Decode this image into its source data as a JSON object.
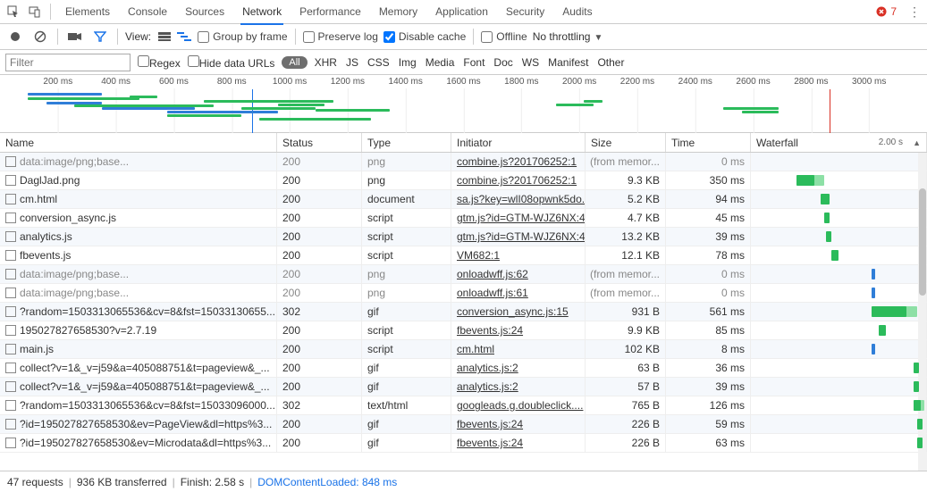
{
  "tabs": [
    "Elements",
    "Console",
    "Sources",
    "Network",
    "Performance",
    "Memory",
    "Application",
    "Security",
    "Audits"
  ],
  "active_tab_index": 3,
  "error_count": "7",
  "toolbar": {
    "view_label": "View:",
    "group_by_frame": "Group by frame",
    "preserve_log": "Preserve log",
    "disable_cache": "Disable cache",
    "disable_cache_checked": true,
    "offline": "Offline",
    "no_throttling": "No throttling"
  },
  "filter": {
    "placeholder": "Filter",
    "regex": "Regex",
    "hide_data_urls": "Hide data URLs",
    "all": "All",
    "types": [
      "XHR",
      "JS",
      "CSS",
      "Img",
      "Media",
      "Font",
      "Doc",
      "WS",
      "Manifest",
      "Other"
    ]
  },
  "overview": {
    "ticks": [
      "200 ms",
      "400 ms",
      "600 ms",
      "800 ms",
      "1000 ms",
      "1200 ms",
      "1400 ms",
      "1600 ms",
      "1800 ms",
      "2000 ms",
      "2200 ms",
      "2400 ms",
      "2600 ms",
      "2800 ms",
      "3000 ms"
    ],
    "blue_line_pct": 27.2,
    "red_line_pct": 89.5
  },
  "columns": {
    "name": "Name",
    "status": "Status",
    "type": "Type",
    "initiator": "Initiator",
    "size": "Size",
    "time": "Time",
    "waterfall": "Waterfall",
    "waterfall_mark": "2.00 s"
  },
  "rows": [
    {
      "name": "data:image/png;base...",
      "status": "200",
      "type": "png",
      "initiator": "combine.js?201706252:1",
      "size": "(from memor...",
      "time": "0 ms",
      "grey": true,
      "wf": []
    },
    {
      "name": "DaglJad.png",
      "status": "200",
      "type": "png",
      "initiator": "combine.js?201706252:1",
      "size": "9.3 KB",
      "time": "350 ms",
      "wf": [
        {
          "l": 26,
          "w": 16,
          "cls": "wf-lightgreen"
        },
        {
          "l": 26,
          "w": 10,
          "cls": "wf-green"
        }
      ]
    },
    {
      "name": "cm.html",
      "status": "200",
      "type": "document",
      "initiator": "sa.js?key=wlI08opwnk5do...",
      "size": "5.2 KB",
      "time": "94 ms",
      "wf": [
        {
          "l": 40,
          "w": 5,
          "cls": "wf-green"
        }
      ]
    },
    {
      "name": "conversion_async.js",
      "status": "200",
      "type": "script",
      "initiator": "gtm.js?id=GTM-WJZ6NX:44",
      "size": "4.7 KB",
      "time": "45 ms",
      "wf": [
        {
          "l": 42,
          "w": 3,
          "cls": "wf-green"
        }
      ]
    },
    {
      "name": "analytics.js",
      "status": "200",
      "type": "script",
      "initiator": "gtm.js?id=GTM-WJZ6NX:44",
      "size": "13.2 KB",
      "time": "39 ms",
      "wf": [
        {
          "l": 43,
          "w": 3,
          "cls": "wf-green"
        }
      ]
    },
    {
      "name": "fbevents.js",
      "status": "200",
      "type": "script",
      "initiator": "VM682:1",
      "size": "12.1 KB",
      "time": "78 ms",
      "wf": [
        {
          "l": 46,
          "w": 4,
          "cls": "wf-green"
        }
      ]
    },
    {
      "name": "data:image/png;base...",
      "status": "200",
      "type": "png",
      "initiator": "onloadwff.js:62",
      "size": "(from memor...",
      "time": "0 ms",
      "grey": true,
      "wf": [
        {
          "l": 69,
          "w": 2,
          "cls": "wf-blue"
        }
      ]
    },
    {
      "name": "data:image/png;base...",
      "status": "200",
      "type": "png",
      "initiator": "onloadwff.js:61",
      "size": "(from memor...",
      "time": "0 ms",
      "grey": true,
      "wf": [
        {
          "l": 69,
          "w": 2,
          "cls": "wf-blue"
        }
      ]
    },
    {
      "name": "?random=1503313065536&cv=8&fst=15033130655...",
      "status": "302",
      "type": "gif",
      "initiator": "conversion_async.js:15",
      "size": "931 B",
      "time": "561 ms",
      "wf": [
        {
          "l": 69,
          "w": 26,
          "cls": "wf-lightgreen"
        },
        {
          "l": 69,
          "w": 20,
          "cls": "wf-green"
        }
      ]
    },
    {
      "name": "195027827658530?v=2.7.19",
      "status": "200",
      "type": "script",
      "initiator": "fbevents.js:24",
      "size": "9.9 KB",
      "time": "85 ms",
      "wf": [
        {
          "l": 73,
          "w": 4,
          "cls": "wf-green"
        }
      ]
    },
    {
      "name": "main.js",
      "status": "200",
      "type": "script",
      "initiator": "cm.html",
      "size": "102 KB",
      "time": "8 ms",
      "wf": [
        {
          "l": 69,
          "w": 2,
          "cls": "wf-blue"
        }
      ]
    },
    {
      "name": "collect?v=1&_v=j59&a=405088751&t=pageview&_...",
      "status": "200",
      "type": "gif",
      "initiator": "analytics.js:2",
      "size": "63 B",
      "time": "36 ms",
      "wf": [
        {
          "l": 93,
          "w": 3,
          "cls": "wf-green"
        }
      ]
    },
    {
      "name": "collect?v=1&_v=j59&a=405088751&t=pageview&_...",
      "status": "200",
      "type": "gif",
      "initiator": "analytics.js:2",
      "size": "57 B",
      "time": "39 ms",
      "wf": [
        {
          "l": 93,
          "w": 3,
          "cls": "wf-green"
        }
      ]
    },
    {
      "name": "?random=1503313065536&cv=8&fst=15033096000...",
      "status": "302",
      "type": "text/html",
      "initiator": "googleads.g.doubleclick....",
      "size": "765 B",
      "time": "126 ms",
      "wf": [
        {
          "l": 93,
          "w": 6,
          "cls": "wf-lightgreen"
        },
        {
          "l": 93,
          "w": 4,
          "cls": "wf-green"
        }
      ]
    },
    {
      "name": "?id=195027827658530&ev=PageView&dl=https%3...",
      "status": "200",
      "type": "gif",
      "initiator": "fbevents.js:24",
      "size": "226 B",
      "time": "59 ms",
      "wf": [
        {
          "l": 95,
          "w": 3,
          "cls": "wf-green"
        }
      ]
    },
    {
      "name": "?id=195027827658530&ev=Microdata&dl=https%3...",
      "status": "200",
      "type": "gif",
      "initiator": "fbevents.js:24",
      "size": "226 B",
      "time": "63 ms",
      "wf": [
        {
          "l": 95,
          "w": 3,
          "cls": "wf-green"
        }
      ]
    }
  ],
  "status": {
    "requests": "47 requests",
    "transferred": "936 KB transferred",
    "finish": "Finish: 2.58 s",
    "dcl": "DOMContentLoaded: 848 ms"
  }
}
